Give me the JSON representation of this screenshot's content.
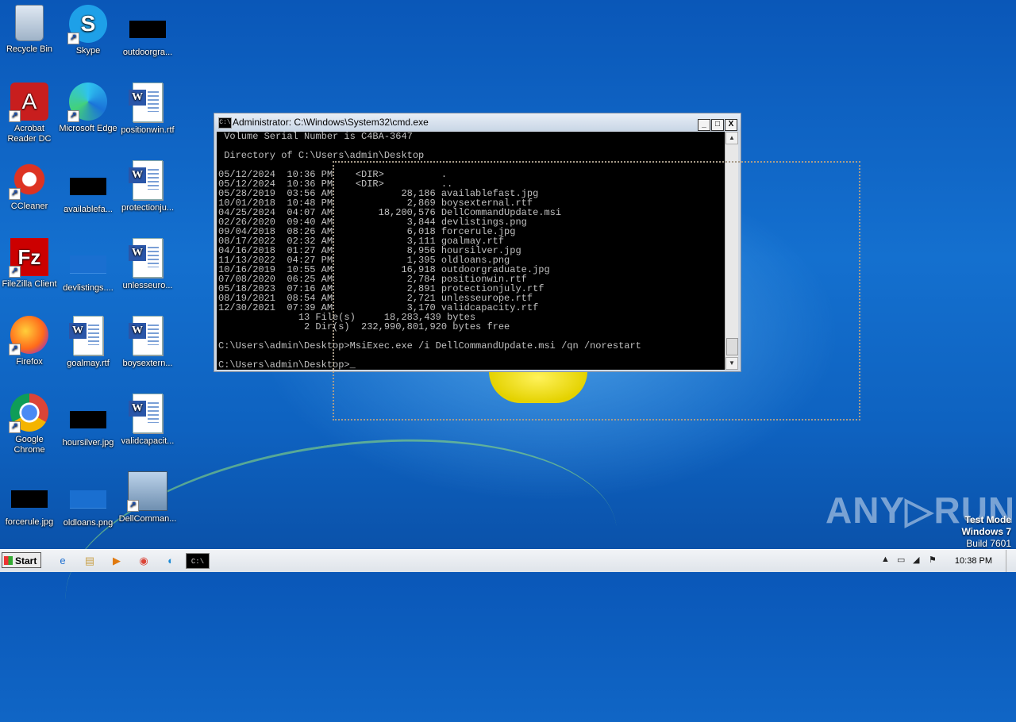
{
  "desktop": {
    "icons": [
      {
        "label": "Recycle Bin"
      },
      {
        "label": "Skype"
      },
      {
        "label": "outdoorgra..."
      },
      {
        "label": "Acrobat\nReader DC"
      },
      {
        "label": "Microsoft Edge"
      },
      {
        "label": "positionwin.rtf"
      },
      {
        "label": "CCleaner"
      },
      {
        "label": "availablefa..."
      },
      {
        "label": "protectionju..."
      },
      {
        "label": "FileZilla Client"
      },
      {
        "label": "devlistings...."
      },
      {
        "label": "unlesseuro..."
      },
      {
        "label": "Firefox"
      },
      {
        "label": "goalmay.rtf"
      },
      {
        "label": "boysextern..."
      },
      {
        "label": "Google\nChrome"
      },
      {
        "label": "hoursilver.jpg"
      },
      {
        "label": "validcapacit..."
      },
      {
        "label": "forcerule.jpg"
      },
      {
        "label": "oldloans.png"
      },
      {
        "label": "DellComman..."
      }
    ]
  },
  "cmd_window": {
    "title": "Administrator: C:\\Windows\\System32\\cmd.exe",
    "icon_text": "C:\\",
    "minimize": "_",
    "maximize": "□",
    "close": "X",
    "console_text": " Volume Serial Number is C4BA-3647\n\n Directory of C:\\Users\\admin\\Desktop\n\n05/12/2024  10:36 PM    <DIR>          .\n05/12/2024  10:36 PM    <DIR>          ..\n05/28/2019  03:56 AM            28,186 availablefast.jpg\n10/01/2018  10:48 PM             2,869 boysexternal.rtf\n04/25/2024  04:07 AM        18,200,576 DellCommandUpdate.msi\n02/26/2020  09:40 AM             3,844 devlistings.png\n09/04/2018  08:26 AM             6,018 forcerule.jpg\n08/17/2022  02:32 AM             3,111 goalmay.rtf\n04/16/2018  01:27 AM             8,956 hoursilver.jpg\n11/13/2022  04:27 PM             1,395 oldloans.png\n10/16/2019  10:55 AM            16,918 outdoorgraduate.jpg\n07/08/2020  06:25 AM             2,784 positionwin.rtf\n05/18/2023  07:16 AM             2,891 protectionjuly.rtf\n08/19/2021  08:54 AM             2,721 unlesseurope.rtf\n12/30/2021  07:39 AM             3,170 validcapacity.rtf\n              13 File(s)     18,283,439 bytes\n               2 Dir(s)  232,990,801,920 bytes free\n\nC:\\Users\\admin\\Desktop>MsiExec.exe /i DellCommandUpdate.msi /qn /norestart\n\nC:\\Users\\admin\\Desktop>_"
  },
  "watermark": {
    "brand": "ANY▷RUN",
    "test_mode": "Test Mode",
    "os": "Windows 7",
    "build": "Build 7601"
  },
  "taskbar": {
    "start_label": "Start",
    "clock": "10:38 PM",
    "cmd_icon_text": "C:\\"
  }
}
